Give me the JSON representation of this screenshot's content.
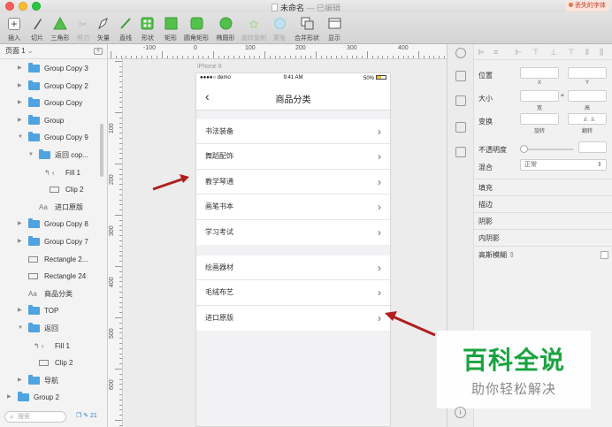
{
  "window": {
    "title": "未命名",
    "edited": "— 已编辑",
    "missing_fonts": "丢失的字体"
  },
  "toolbar": [
    {
      "label": "插入",
      "icon": "plus-icon"
    },
    {
      "label": "切片",
      "icon": "knife-icon"
    },
    {
      "label": "三角形",
      "icon": "triangle-icon"
    },
    {
      "label": "剪刀",
      "icon": "scissors-icon"
    },
    {
      "label": "矢量",
      "icon": "pen-icon"
    },
    {
      "label": "直线",
      "icon": "line-icon"
    },
    {
      "label": "形状",
      "icon": "shape-icon"
    },
    {
      "label": "矩形",
      "icon": "rectangle-icon"
    },
    {
      "label": "圆角矩形",
      "icon": "rounded-rect-icon"
    },
    {
      "label": "椭圆形",
      "icon": "oval-icon"
    },
    {
      "label": "旋转复制",
      "icon": "rotate-copy-icon"
    },
    {
      "label": "蒙版",
      "icon": "mask-icon"
    },
    {
      "label": "合并形状",
      "icon": "combine-icon"
    },
    {
      "label": "显示",
      "icon": "view-icon"
    }
  ],
  "layers": {
    "page": "页面 1",
    "items": [
      {
        "label": "Group Copy 3",
        "type": "folder",
        "indent": 0,
        "expanded": false
      },
      {
        "label": "Group Copy 2",
        "type": "folder",
        "indent": 0,
        "expanded": false
      },
      {
        "label": "Group Copy",
        "type": "folder",
        "indent": 0,
        "expanded": false
      },
      {
        "label": "Group",
        "type": "folder",
        "indent": 0,
        "expanded": false
      },
      {
        "label": "Group Copy 9",
        "type": "folder",
        "indent": 0,
        "expanded": true
      },
      {
        "label": "返回 cop...",
        "type": "folder",
        "indent": 1,
        "expanded": true
      },
      {
        "label": "Fill 1",
        "type": "chevron",
        "indent": 2
      },
      {
        "label": "Clip 2",
        "type": "rect",
        "indent": 2
      },
      {
        "label": "进口原版",
        "type": "text",
        "indent": 1
      },
      {
        "label": "Group Copy 8",
        "type": "folder",
        "indent": 0,
        "expanded": false
      },
      {
        "label": "Group Copy 7",
        "type": "folder",
        "indent": 0,
        "expanded": false
      },
      {
        "label": "Rectangle 2...",
        "type": "rect",
        "indent": 0
      },
      {
        "label": "Rectangle 24",
        "type": "rect",
        "indent": 0
      },
      {
        "label": "商品分类",
        "type": "text",
        "indent": 0
      },
      {
        "label": "TOP",
        "type": "folder",
        "indent": 0,
        "expanded": false
      },
      {
        "label": "返回",
        "type": "folder",
        "indent": 0,
        "expanded": true
      },
      {
        "label": "Fill 1",
        "type": "chevron",
        "indent": 1
      },
      {
        "label": "Clip 2",
        "type": "rect",
        "indent": 1
      },
      {
        "label": "导航",
        "type": "folder",
        "indent": 0,
        "expanded": false
      },
      {
        "label": "Group 2",
        "type": "folder",
        "indent": -1,
        "expanded": false
      }
    ],
    "search_placeholder": "搜索",
    "count": "21"
  },
  "rulers": {
    "top": [
      "-100",
      "0",
      "100",
      "200",
      "300",
      "400"
    ],
    "left": [
      "100",
      "200",
      "300",
      "400",
      "500",
      "600"
    ]
  },
  "artboard": {
    "name": "iPhone 8",
    "status": {
      "carrier": "●●●●○ demo",
      "time": "9:41 AM",
      "battery": "50%"
    },
    "nav_title": "商品分类",
    "back_icon": "back-chevron-icon",
    "group1": [
      "书法装备",
      "舞蹈配饰",
      "教学琴通",
      "画笔书本",
      "学习考试"
    ],
    "group2": [
      "绘画器材",
      "毛绒布艺",
      "进口原版"
    ]
  },
  "inspector": {
    "position": "位置",
    "x": "X",
    "y": "Y",
    "size": "大小",
    "width": "宽",
    "height": "高",
    "transform": "变换",
    "rotate": "旋转",
    "flip": "翻转",
    "opacity": "不透明度",
    "blending": "混合",
    "blending_value": "正常",
    "sections": [
      "填充",
      "描边",
      "阴影",
      "内阴影",
      "高斯模糊"
    ]
  },
  "watermark": {
    "main": "百科全说",
    "sub": "助你轻松解决"
  },
  "colors": {
    "folder": "#4fa3e0",
    "arrow": "#b01e1e",
    "watermark_green": "#1aa340"
  }
}
